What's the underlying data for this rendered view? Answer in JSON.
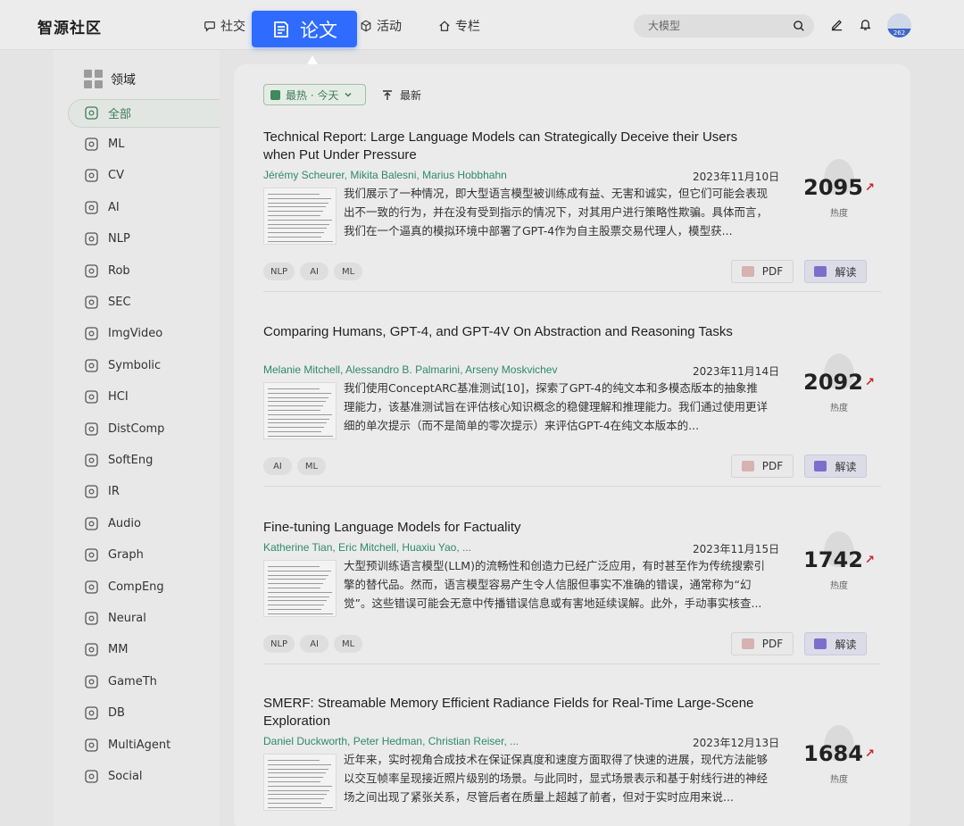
{
  "header": {
    "logo": "智源社区",
    "nav": [
      {
        "label": "社交",
        "icon": "chat-bubble-icon"
      },
      {
        "label": "论文",
        "icon": "document-icon",
        "active": true
      },
      {
        "label": "活动",
        "icon": "cube-icon"
      },
      {
        "label": "专栏",
        "icon": "home-icon"
      }
    ],
    "search_placeholder": "大模型",
    "avatar_badge": "262"
  },
  "sidebar": {
    "header": "领域",
    "items": [
      {
        "label": "全部",
        "icon": "layers-icon",
        "active": true
      },
      {
        "label": "ML",
        "icon": "ml-icon"
      },
      {
        "label": "CV",
        "icon": "camera-icon"
      },
      {
        "label": "AI",
        "icon": "ai-icon"
      },
      {
        "label": "NLP",
        "icon": "nlp-icon"
      },
      {
        "label": "Rob",
        "icon": "robot-arm-icon"
      },
      {
        "label": "SEC",
        "icon": "shield-icon"
      },
      {
        "label": "ImgVideo",
        "icon": "image-video-icon"
      },
      {
        "label": "Symbolic",
        "icon": "symbolic-icon"
      },
      {
        "label": "HCI",
        "icon": "hci-icon"
      },
      {
        "label": "DistComp",
        "icon": "distributed-icon"
      },
      {
        "label": "SoftEng",
        "icon": "code-icon"
      },
      {
        "label": "IR",
        "icon": "retrieval-icon"
      },
      {
        "label": "Audio",
        "icon": "audio-wave-icon"
      },
      {
        "label": "Graph",
        "icon": "graph-icon"
      },
      {
        "label": "CompEng",
        "icon": "folder-icon"
      },
      {
        "label": "Neural",
        "icon": "neural-icon"
      },
      {
        "label": "MM",
        "icon": "play-icon"
      },
      {
        "label": "GameTh",
        "icon": "game-icon"
      },
      {
        "label": "DB",
        "icon": "database-icon"
      },
      {
        "label": "MultiAgent",
        "icon": "multiagent-icon"
      },
      {
        "label": "Social",
        "icon": "social-icon"
      }
    ]
  },
  "main": {
    "filter_label": "最热 · 今天",
    "newest_label": "最新",
    "papers": [
      {
        "title": "Technical Report: Large Language Models can Strategically Deceive their Users when Put Under Pressure",
        "authors": "Jérémy Scheurer, Mikita Balesni, Marius Hobbhahn",
        "date": "2023年11月10日",
        "abstract": "我们展示了一种情况，即大型语言模型被训练成有益、无害和诚实，但它们可能会表现出不一致的行为，并在没有受到指示的情况下，对其用户进行策略性欺骗。具体而言，我们在一个逼真的模拟环境中部署了GPT-4作为自主股票交易代理人，模型获...",
        "tags": [
          "NLP",
          "AI",
          "ML"
        ],
        "heat": "2095",
        "heat_label": "热度",
        "pdf_label": "PDF",
        "read_label": "解读"
      },
      {
        "title": "Comparing Humans, GPT-4, and GPT-4V On Abstraction and Reasoning Tasks",
        "authors": "Melanie Mitchell, Alessandro B. Palmarini, Arseny Moskvichev",
        "date": "2023年11月14日",
        "abstract": "我们使用ConceptARC基准测试[10]，探索了GPT-4的纯文本和多模态版本的抽象推理能力，该基准测试旨在评估核心知识概念的稳健理解和推理能力。我们通过使用更详细的单次提示（而不是简单的零次提示）来评估GPT-4在纯文本版本的...",
        "tags": [
          "AI",
          "ML"
        ],
        "heat": "2092",
        "heat_label": "热度",
        "pdf_label": "PDF",
        "read_label": "解读"
      },
      {
        "title": "Fine-tuning Language Models for Factuality",
        "authors": "Katherine Tian, Eric Mitchell, Huaxiu Yao, ...",
        "date": "2023年11月15日",
        "abstract": "大型预训练语言模型(LLM)的流畅性和创造力已经广泛应用，有时甚至作为传统搜索引擎的替代品。然而，语言模型容易产生令人信服但事实不准确的错误，通常称为“幻觉”。这些错误可能会无意中传播错误信息或有害地延续误解。此外，手动事实核查...",
        "tags": [
          "NLP",
          "AI",
          "ML"
        ],
        "heat": "1742",
        "heat_label": "热度",
        "pdf_label": "PDF",
        "read_label": "解读"
      },
      {
        "title": "SMERF: Streamable Memory Efficient Radiance Fields for Real-Time Large-Scene Exploration",
        "authors": "Daniel Duckworth, Peter Hedman, Christian Reiser, ...",
        "date": "2023年12月13日",
        "abstract": "近年来，实时视角合成技术在保证保真度和速度方面取得了快速的进展，现代方法能够以交互帧率呈现接近照片级别的场景。与此同时，显式场景表示和基于射线行进的神经场之间出现了紧张关系，尽管后者在质量上超越了前者，但对于实时应用来说...",
        "tags": [],
        "heat": "1684",
        "heat_label": "热度",
        "pdf_label": "PDF",
        "read_label": "解读"
      }
    ]
  },
  "colors": {
    "accent": "#2f6bff",
    "author_green": "#2e8a6a",
    "sidebar_active": "#3d7c58",
    "heat_arrow": "#d02020"
  }
}
